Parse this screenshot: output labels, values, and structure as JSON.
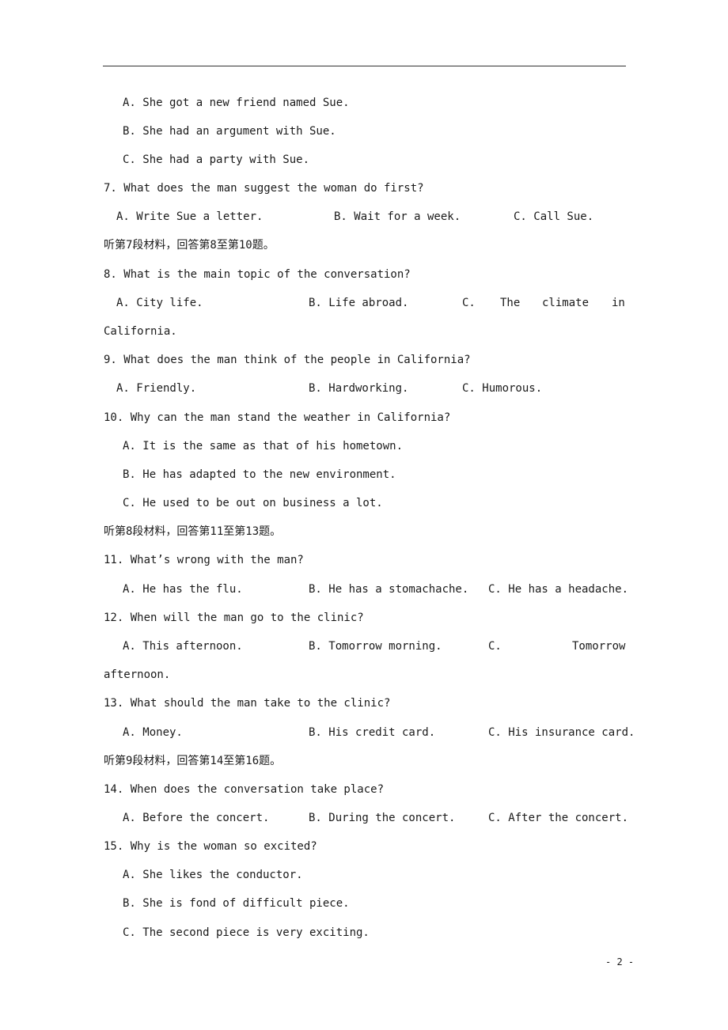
{
  "page_number": "- 2 -",
  "q6_options": {
    "a": "A. She got a new friend named Sue.",
    "b": "B. She had an argument with Sue.",
    "c": "C. She had a party with Sue."
  },
  "q7": {
    "question": "7. What does the man suggest the woman do first?",
    "a": "A. Write Sue a letter.",
    "b": "B. Wait for a week.",
    "c": "C. Call Sue."
  },
  "section7": "听第7段材料，回答第8至第10题。",
  "q8": {
    "question": "8. What is the main topic of the conversation?",
    "a": "A. City life.",
    "b": "B. Life abroad.",
    "c_part1": "C.",
    "c_part2": "The",
    "c_part3": "climate",
    "c_part4": "in",
    "c_wrap": "California."
  },
  "q9": {
    "question": "9. What does the man think of the people in California?",
    "a": "A. Friendly.",
    "b": "B. Hardworking.",
    "c": "C. Humorous."
  },
  "q10": {
    "question": "10. Why can the man stand the weather in California?",
    "a": "A. It is the same as that of his hometown.",
    "b": "B. He has adapted to the new environment.",
    "c": "C. He used to be out on business a lot."
  },
  "section8": "听第8段材料，回答第11至第13题。",
  "q11": {
    "question": "11. What’s wrong with the man?",
    "a": "A. He has the flu.",
    "b": "B. He has a stomachache.",
    "c": "C. He has a headache."
  },
  "q12": {
    "question": "12. When will the man go to the clinic?",
    "a": "A. This afternoon.",
    "b": "B. Tomorrow morning.",
    "c_part1": "C.",
    "c_part2": "Tomorrow",
    "c_wrap": "afternoon."
  },
  "q13": {
    "question": "13. What should the man take to the clinic?",
    "a": "A. Money.",
    "b": "B. His credit card.",
    "c": "C. His insurance card."
  },
  "section9": "听第9段材料，回答第14至第16题。",
  "q14": {
    "question": "14. When does the conversation take place?",
    "a": "A. Before the concert.",
    "b": "B. During the concert.",
    "c": "C. After the concert."
  },
  "q15": {
    "question": "15. Why is the woman so excited?",
    "a": "A. She likes the conductor.",
    "b": "B. She is fond of difficult piece.",
    "c": "C. The second piece is very exciting."
  }
}
